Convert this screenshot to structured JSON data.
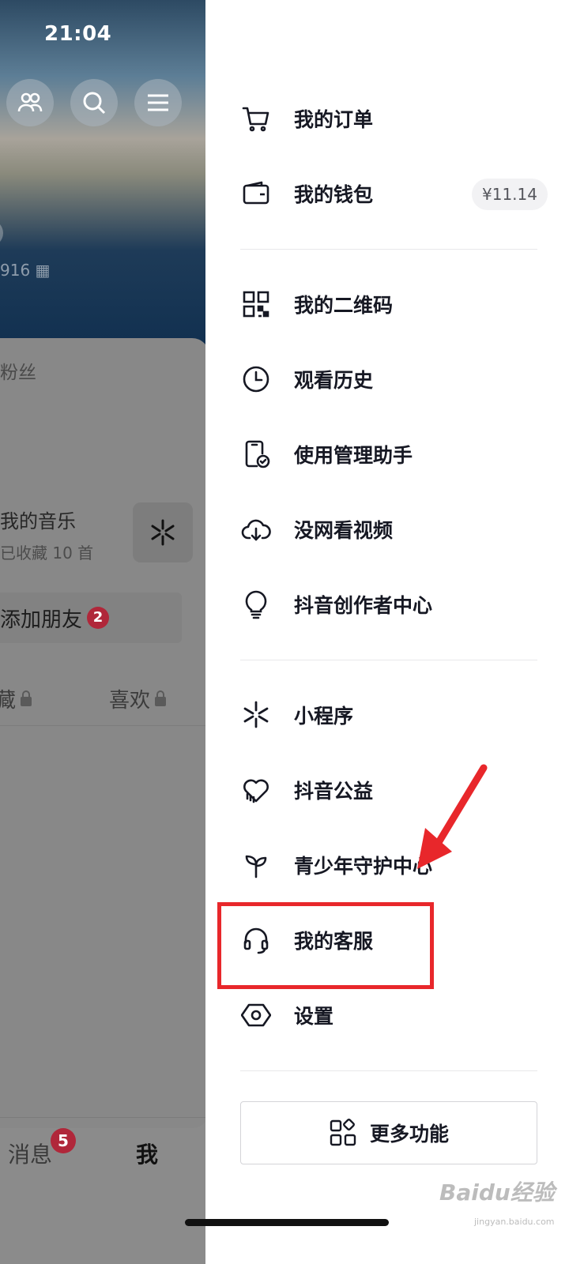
{
  "status_bar": {
    "time": "21:04"
  },
  "background_profile": {
    "id_fragment": "916",
    "fans_label": "粉丝",
    "music_title": "我的音乐",
    "music_sub": "已收藏 10 首",
    "add_friend": "添加朋友",
    "add_friend_badge": "2",
    "tab_favorites": "藏",
    "tab_likes": "喜欢",
    "nav_messages": "消息",
    "nav_messages_badge": "5",
    "nav_me": "我"
  },
  "drawer": {
    "items": [
      {
        "label": "我的订单",
        "icon": "cart-icon"
      },
      {
        "label": "我的钱包",
        "icon": "wallet-icon",
        "amount": "¥11.14"
      },
      {
        "label": "我的二维码",
        "icon": "qr-code-icon"
      },
      {
        "label": "观看历史",
        "icon": "clock-icon"
      },
      {
        "label": "使用管理助手",
        "icon": "phone-check-icon"
      },
      {
        "label": "没网看视频",
        "icon": "cloud-download-icon"
      },
      {
        "label": "抖音创作者中心",
        "icon": "lightbulb-icon"
      },
      {
        "label": "小程序",
        "icon": "mini-program-icon"
      },
      {
        "label": "抖音公益",
        "icon": "heart-charity-icon"
      },
      {
        "label": "青少年守护中心",
        "icon": "sprout-icon"
      },
      {
        "label": "我的客服",
        "icon": "headset-icon"
      },
      {
        "label": "设置",
        "icon": "hexagon-settings-icon"
      }
    ],
    "more_button": "更多功能"
  },
  "annotation": {
    "highlight_color": "#e8272b"
  },
  "watermark": {
    "text": "Baidu经验",
    "sub": "jingyan.baidu.com"
  }
}
